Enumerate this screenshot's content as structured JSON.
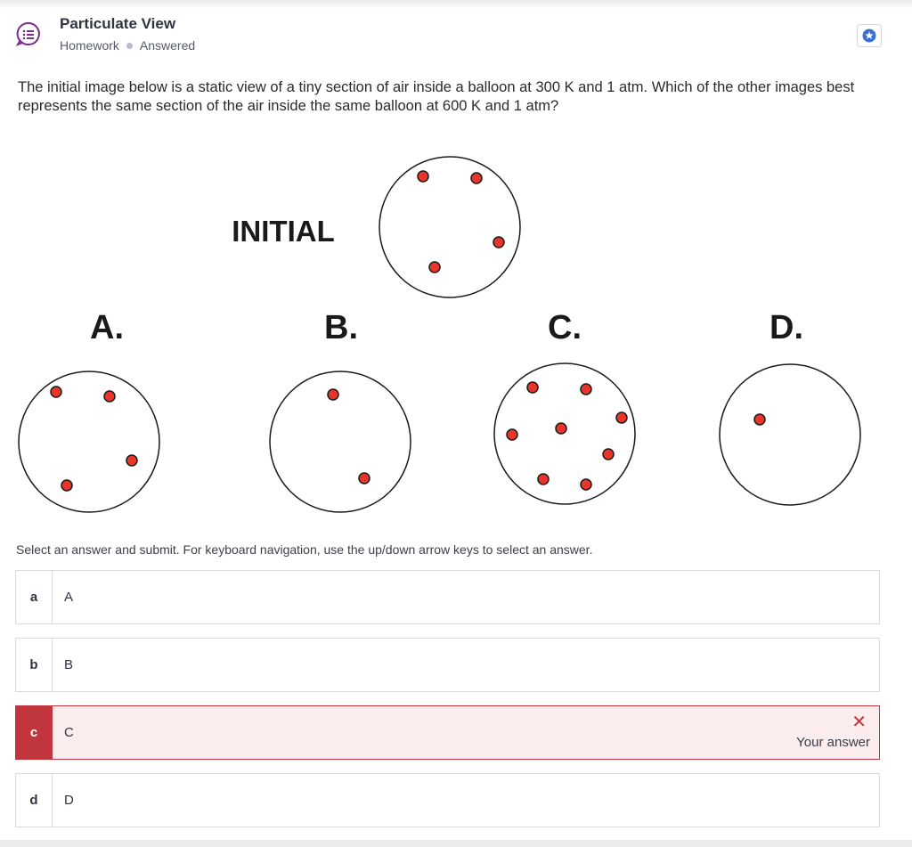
{
  "header": {
    "title": "Particulate View",
    "category": "Homework",
    "status": "Answered",
    "icon": "question-list-icon",
    "bookmark_icon": "star-icon"
  },
  "question": {
    "text": "The initial image below is a static view of a tiny section of air inside a balloon at 300 K and 1 atm. Which of the other images best represents the same section of the air inside the same balloon at 600 K and 1 atm?"
  },
  "figure": {
    "initial_label": "INITIAL",
    "labels": [
      "A.",
      "B.",
      "C.",
      "D."
    ],
    "particle_color": "#e8352a"
  },
  "instructions": "Select an answer and submit. For keyboard navigation, use the up/down arrow keys to select an answer.",
  "options": [
    {
      "letter": "a",
      "text": "A"
    },
    {
      "letter": "b",
      "text": "B"
    },
    {
      "letter": "c",
      "text": "C",
      "result_label": "Your answer"
    },
    {
      "letter": "d",
      "text": "D"
    }
  ],
  "colors": {
    "accent": "#7b2d8e",
    "wrong": "#c0363c",
    "star": "#3a6fd8"
  }
}
